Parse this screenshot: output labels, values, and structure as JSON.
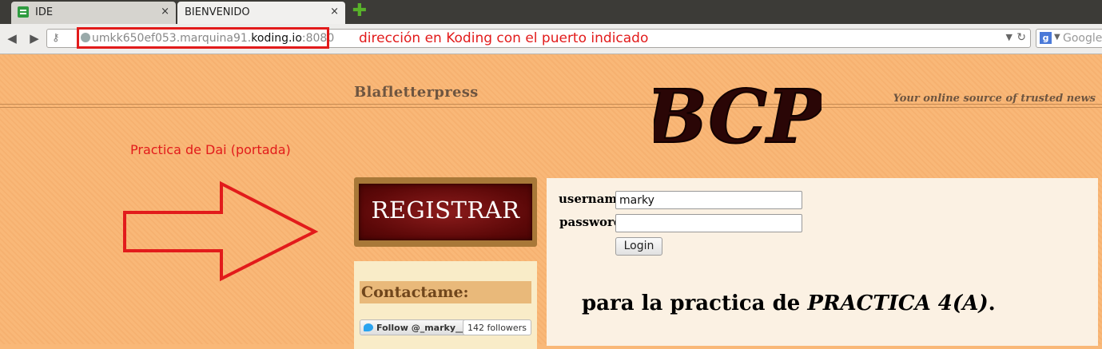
{
  "browser": {
    "tabs": [
      {
        "label": "IDE",
        "close": "×"
      },
      {
        "label": "BIENVENIDO",
        "close": "×"
      }
    ],
    "newtab_label": "✚",
    "url": {
      "prefix": "umkk650ef053.marquina91.",
      "domain": "koding.io",
      "port": ":8080"
    },
    "annotation": "dirección en Koding con el puerto indicado",
    "search_placeholder": "Google",
    "search_engine_letter": "g"
  },
  "site": {
    "name": "Blafletterpress",
    "tagline": "Your online source of trusted news",
    "logo_text": "BCP"
  },
  "annotations": {
    "note": "Practica de Dai (portada)",
    "accent_color": "#e21b1b"
  },
  "register": {
    "label": "REGISTRAR"
  },
  "contact": {
    "title": "Contactame:",
    "follow_label": "Follow @_marky__",
    "followers": "142 followers"
  },
  "login": {
    "username_label": "username",
    "username_value": "marky",
    "password_label": "password",
    "password_value": "",
    "button_label": "Login"
  },
  "headline": {
    "prefix": "para la practica de ",
    "emphasis": "PRACTICA 4(A)",
    "suffix": "."
  }
}
